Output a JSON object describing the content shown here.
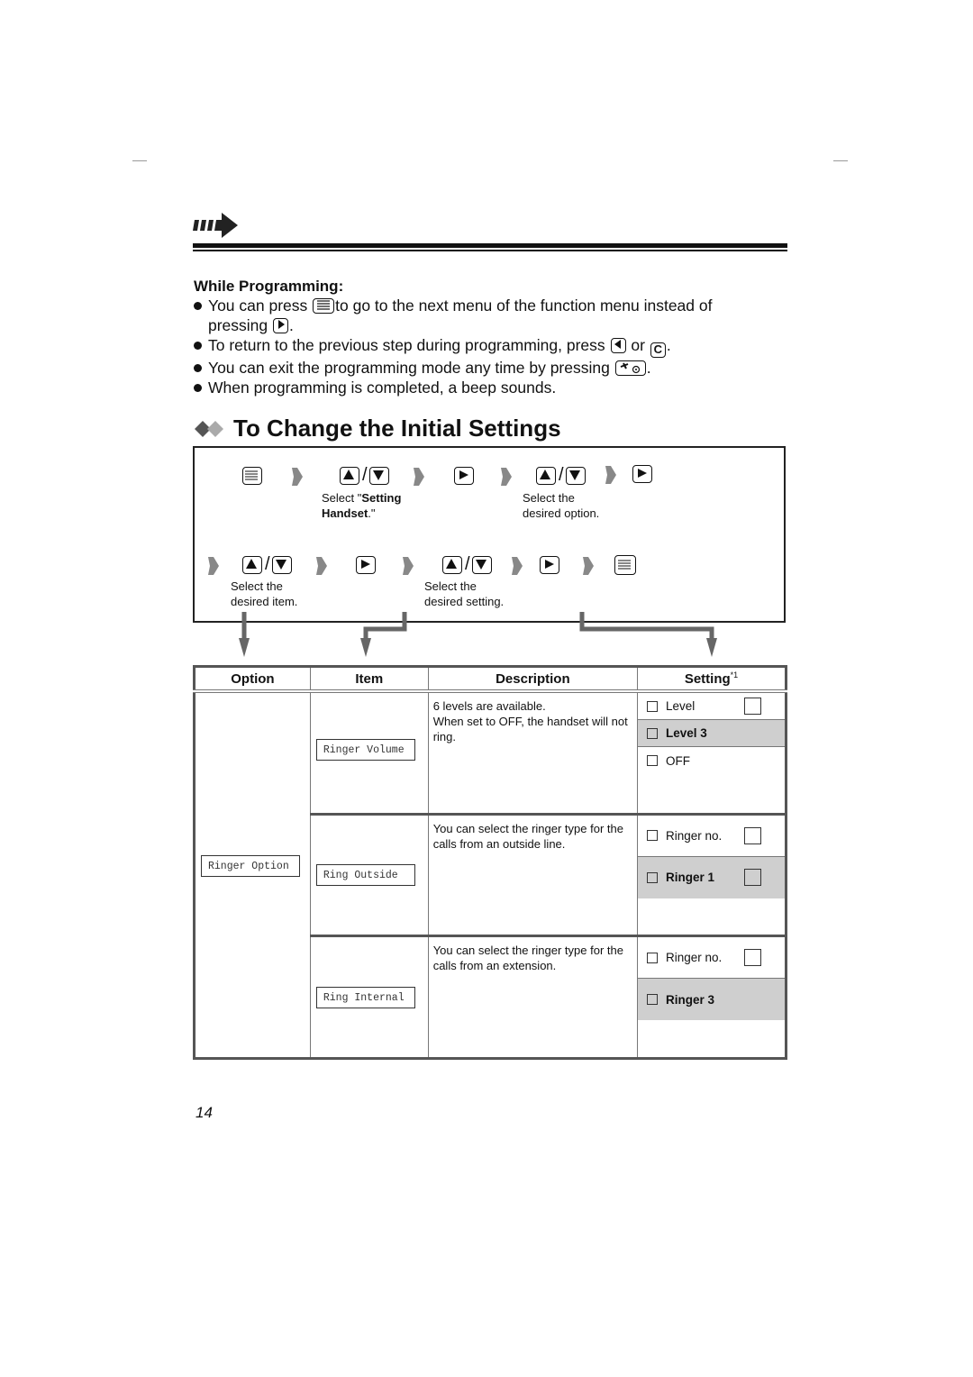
{
  "while_programming": {
    "title": "While Programming:",
    "bullets": [
      {
        "before": "You can press",
        "key1": "menu-key",
        "middle": "to go to the next menu of the function menu instead of pressing",
        "key2": "right-key",
        "after": "."
      },
      {
        "before": "To return to the previous step during programming, press",
        "key1": "left-key",
        "middle": "or",
        "key2": "c-key",
        "after": "."
      },
      {
        "before": "You can exit the programming mode any time by pressing",
        "key1": "off-key",
        "after": "."
      },
      {
        "before": "When programming is completed, a beep sounds."
      }
    ],
    "keys": {
      "c": "C"
    }
  },
  "section": {
    "title": "To Change the Initial Settings"
  },
  "flow": {
    "step1_label_a": "Select \"",
    "step1_label_bold1": "Setting",
    "step1_label_bold2": "Handset",
    "step1_label_b": ".\"",
    "step2_label_line1": "Select the",
    "step2_label_line2": "desired option.",
    "step3_label_line1": "Select the",
    "step3_label_line2": "desired item.",
    "step4_label_line1": "Select the",
    "step4_label_line2": "desired setting.",
    "slash": "/"
  },
  "table": {
    "headers": {
      "option": "Option",
      "item": "Item",
      "description": "Description",
      "setting": "Setting",
      "setting_note": "*1"
    },
    "option": "Ringer Option",
    "rows": [
      {
        "item": "Ringer Volume",
        "description_line1": "6 levels are available.",
        "description_line2": "When set to OFF, the handset will not ring.",
        "settings": [
          {
            "label": "Level",
            "has_entry": true,
            "default": false
          },
          {
            "label": "Level 3",
            "has_entry": false,
            "default": true
          },
          {
            "label": "OFF",
            "has_entry": false,
            "default": false
          }
        ]
      },
      {
        "item": "Ring Outside",
        "description": "You can select the ringer type for the calls from an outside line.",
        "settings": [
          {
            "label": "Ringer no.",
            "has_entry": true,
            "default": false
          },
          {
            "label": "Ringer 1",
            "has_entry": true,
            "default": true
          }
        ]
      },
      {
        "item": "Ring Internal",
        "description": "You can select the ringer type for the calls from an extension.",
        "settings": [
          {
            "label": "Ringer no.",
            "has_entry": true,
            "default": false
          },
          {
            "label": "Ringer 3",
            "has_entry": false,
            "default": true
          }
        ]
      }
    ]
  },
  "page_number": "14"
}
